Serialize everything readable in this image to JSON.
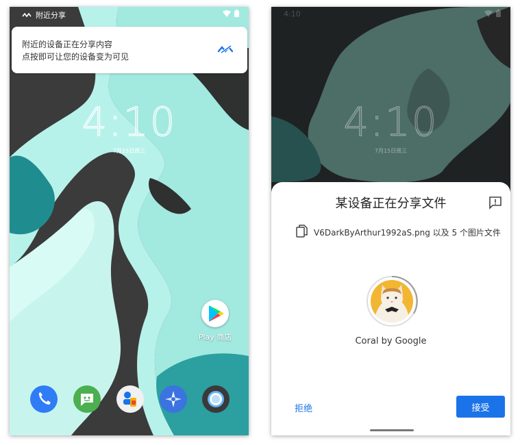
{
  "left_screen": {
    "status_app": "附近分享",
    "notification": {
      "line1": "附近的设备正在分享内容",
      "line2": "点按即可让您的设备变为可见",
      "icon": "nearby-share-icon"
    },
    "clock": "4:10",
    "date": "7月15日周三",
    "play_store_label": "Play 商店",
    "dock_icons": [
      "phone-icon",
      "messages-icon",
      "contacts-icon",
      "compass-icon",
      "camera-lens-icon"
    ]
  },
  "right_screen": {
    "clock": "4:10",
    "date": "7月15日周三",
    "sheet": {
      "title": "某设备正在分享文件",
      "file_text": "V6DarkByArthur1992aS.png 以及 5 个图片文件",
      "device_name": "Coral by Google",
      "decline_label": "拒绝",
      "accept_label": "接受"
    }
  },
  "colors": {
    "accent": "#1a73e8",
    "mint": "#a4ebe3",
    "dark": "#3a3a3a",
    "teal": "#2c9fa0"
  }
}
